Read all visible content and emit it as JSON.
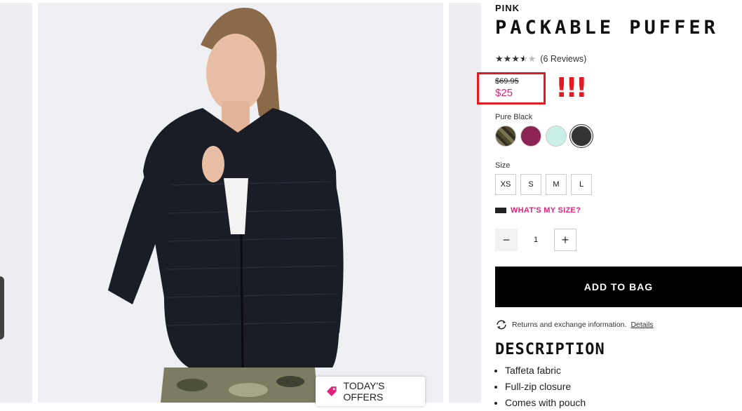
{
  "offers": {
    "label": "TODAY'S OFFERS"
  },
  "product": {
    "brand": "PINK",
    "title": "PACKABLE PUFFER",
    "stars_full": "★★★",
    "stars_half": "★",
    "stars_empty": "★",
    "reviews": "(6 Reviews)",
    "old_price": "$69.95",
    "new_price": "$25",
    "annotation": "!!!",
    "color_label": "Pure Black",
    "swatches": [
      {
        "name": "camo",
        "color": "#5b5a3c"
      },
      {
        "name": "berry",
        "color": "#8a2455"
      },
      {
        "name": "mint",
        "color": "#c9efe6"
      },
      {
        "name": "black",
        "color": "#333333"
      }
    ],
    "size_label": "Size",
    "sizes": [
      "XS",
      "S",
      "M",
      "L"
    ],
    "whats_my_size": "WHAT'S MY SIZE?",
    "quantity": "1",
    "add_to_bag": "ADD TO BAG",
    "returns_text": "Returns and exchange information.",
    "returns_link": "Details",
    "description_title": "DESCRIPTION",
    "description": [
      "Taffeta fabric",
      "Full-zip closure",
      "Comes with pouch"
    ]
  },
  "colors": {
    "accent_pink": "#e0227a",
    "annotation_red": "#e21b23"
  }
}
